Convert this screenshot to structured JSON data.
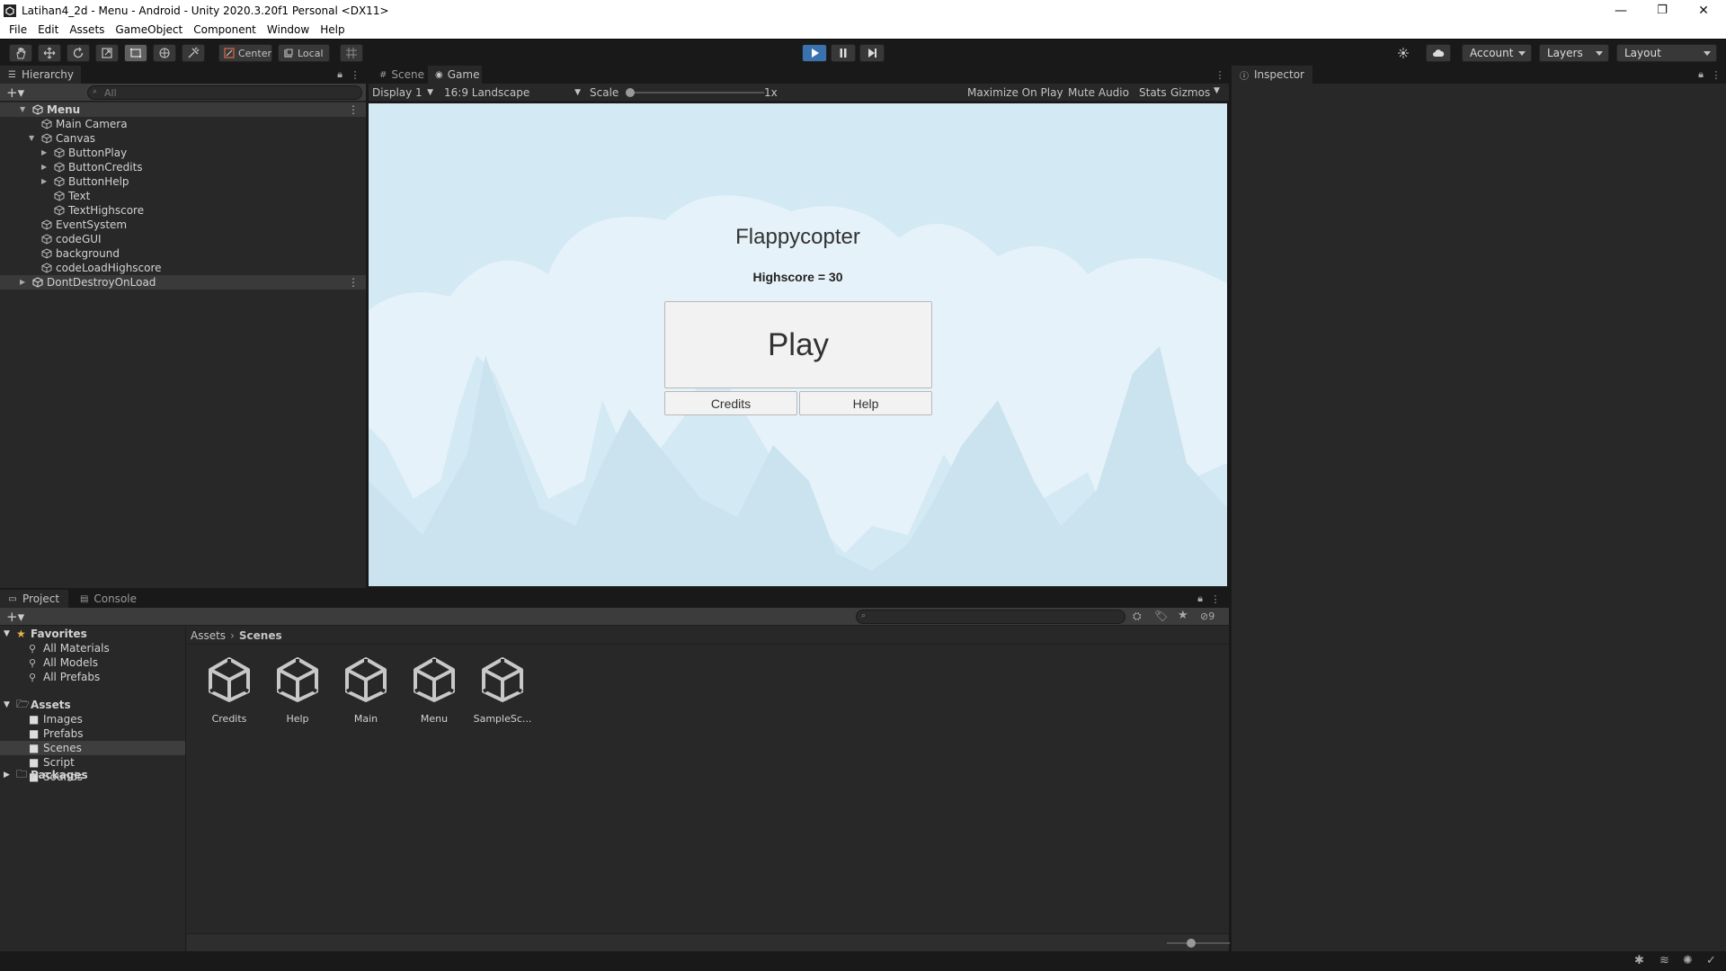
{
  "window": {
    "title": "Latihan4_2d - Menu - Android - Unity 2020.3.20f1 Personal <DX11>",
    "controls": {
      "minimize": "—",
      "restore": "❐",
      "close": "✕"
    }
  },
  "menu": [
    "File",
    "Edit",
    "Assets",
    "GameObject",
    "Component",
    "Window",
    "Help"
  ],
  "toolbar": {
    "pivot_center": "Center",
    "pivot_local": "Local",
    "account": "Account",
    "layers": "Layers",
    "layout": "Layout"
  },
  "hierarchy": {
    "tab": "Hierarchy",
    "search_placeholder": "All",
    "items": [
      {
        "label": "Menu",
        "kind": "scene"
      },
      {
        "label": "Main Camera",
        "kind": "object"
      },
      {
        "label": "Canvas",
        "kind": "object"
      },
      {
        "label": "ButtonPlay",
        "kind": "object"
      },
      {
        "label": "ButtonCredits",
        "kind": "object"
      },
      {
        "label": "ButtonHelp",
        "kind": "object"
      },
      {
        "label": "Text",
        "kind": "object"
      },
      {
        "label": "TextHighscore",
        "kind": "object"
      },
      {
        "label": "EventSystem",
        "kind": "object"
      },
      {
        "label": "codeGUI",
        "kind": "object"
      },
      {
        "label": "background",
        "kind": "object"
      },
      {
        "label": "codeLoadHighscore",
        "kind": "object"
      },
      {
        "label": "DontDestroyOnLoad",
        "kind": "scene"
      }
    ]
  },
  "gameview": {
    "tabs": [
      "Scene",
      "Game"
    ],
    "display": "Display 1",
    "aspect": "16:9 Landscape",
    "scale_label": "Scale",
    "scale_value": "1x",
    "maximize": "Maximize On Play",
    "mute": "Mute Audio",
    "stats": "Stats",
    "gizmos": "Gizmos",
    "game": {
      "title": "Flappycopter",
      "highscore": "Highscore = 30",
      "play": "Play",
      "credits": "Credits",
      "help": "Help"
    },
    "colors": {
      "sky": "#d3e9f4",
      "cloud": "#e6f2f9",
      "mountain": "#cbe3ef"
    }
  },
  "inspector": {
    "tab": "Inspector"
  },
  "project": {
    "tabs": [
      "Project",
      "Console"
    ],
    "hidden_count": "9",
    "breadcrumb": [
      "Assets",
      "Scenes"
    ],
    "favorites_label": "Favorites",
    "favorites": [
      "All Materials",
      "All Models",
      "All Prefabs"
    ],
    "assets_label": "Assets",
    "folders": [
      "Images",
      "Prefabs",
      "Scenes",
      "Script",
      "Sounds"
    ],
    "packages_label": "Packages",
    "scenes": [
      "Credits",
      "Help",
      "Main",
      "Menu",
      "SampleSc..."
    ]
  }
}
